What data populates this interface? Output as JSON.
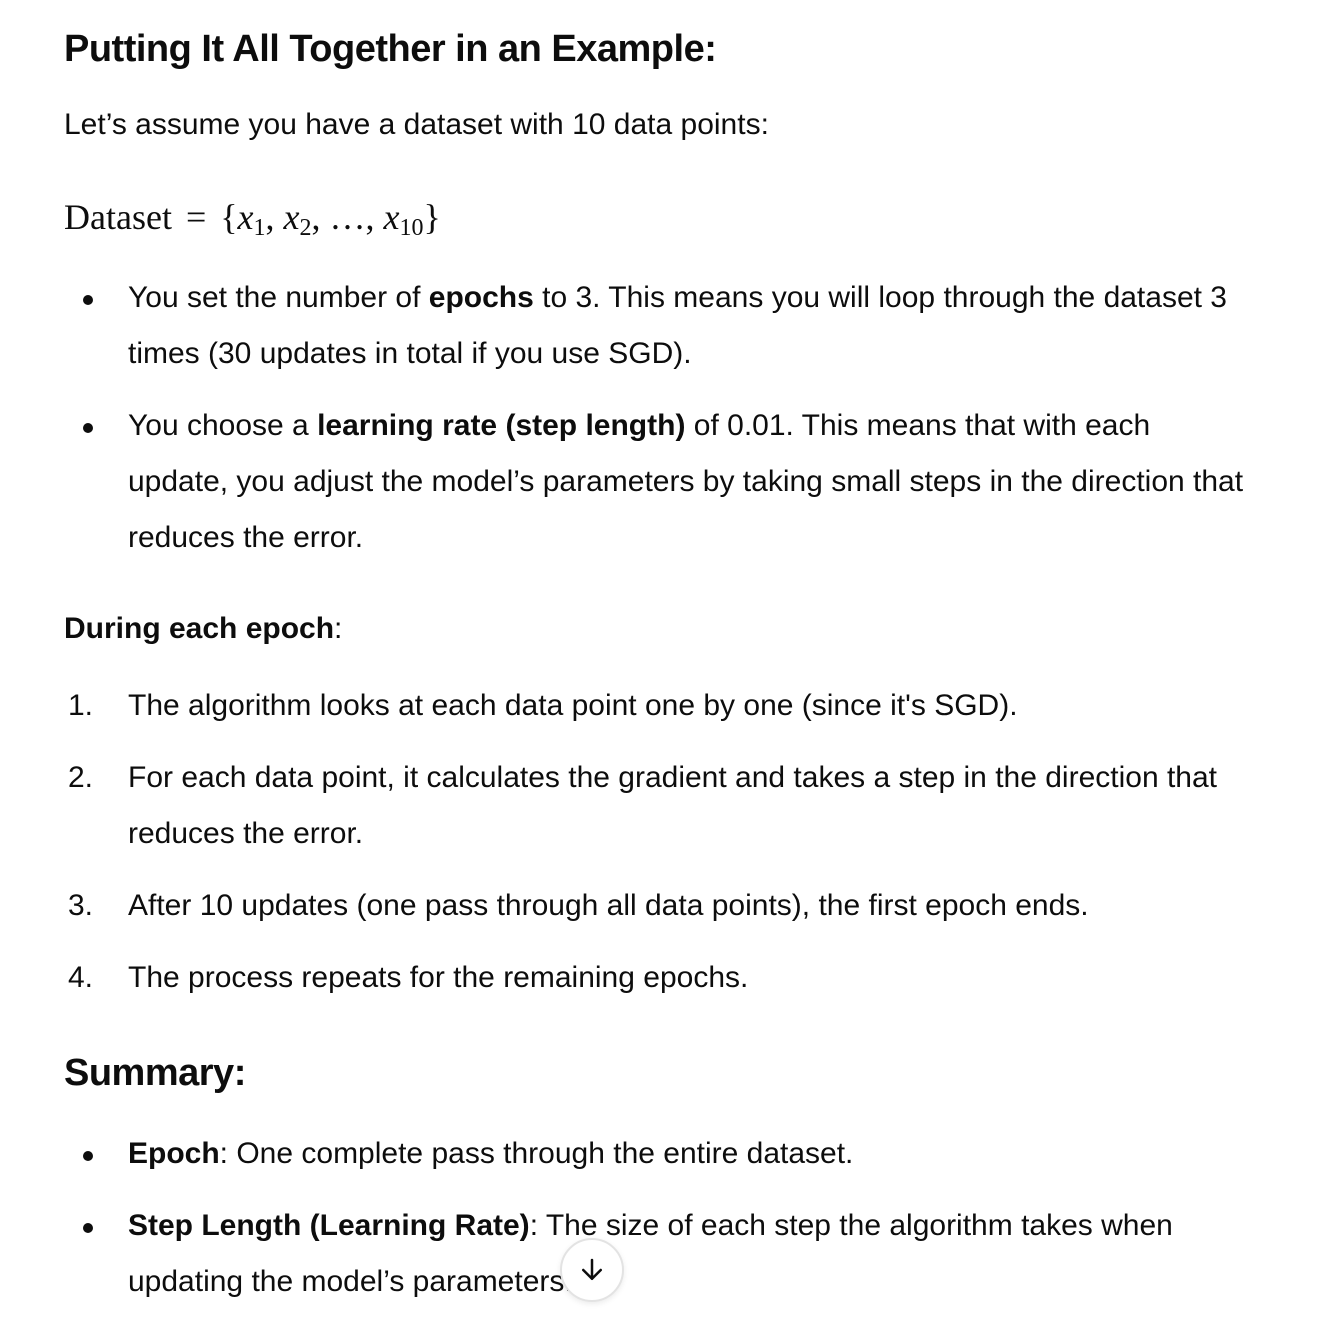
{
  "section1": {
    "heading": "Putting It All Together in an Example:",
    "intro": "Let’s assume you have a dataset with 10 data points:",
    "math": {
      "lhs": "Dataset",
      "rel": "=",
      "open": "{",
      "x1": "x",
      "x1_sub": "1",
      "x2": "x",
      "x2_sub": "2",
      "ellipsis": "…",
      "x10": "x",
      "x10_sub": "10",
      "close": "}",
      "comma": ","
    },
    "bullets": [
      {
        "pre": "You set the number of ",
        "bold": "epochs",
        "post": " to 3. This means you will loop through the dataset 3 times (30 updates in total if you use SGD)."
      },
      {
        "pre": "You choose a ",
        "bold": "learning rate (step length)",
        "post": " of 0.01. This means that with each update, you adjust the model’s parameters by taking small steps in the direction that reduces the error."
      }
    ]
  },
  "section2": {
    "subhead_bold": "During each epoch",
    "subhead_post": ":",
    "steps": [
      {
        "num": "1.",
        "text": "The algorithm looks at each data point one by one (since it's SGD)."
      },
      {
        "num": "2.",
        "text": "For each data point, it calculates the gradient and takes a step in the direction that reduces the error."
      },
      {
        "num": "3.",
        "text": "After 10 updates (one pass through all data points), the first epoch ends."
      },
      {
        "num": "4.",
        "text": "The process repeats for the remaining epochs."
      }
    ]
  },
  "summary": {
    "heading": "Summary:",
    "bullets": [
      {
        "bold": "Epoch",
        "post": ": One complete pass through the entire dataset."
      },
      {
        "bold": "Step Length (Learning Rate)",
        "post": ": The size of each step the algorithm takes when updating the model’s parameters."
      }
    ]
  },
  "scroll_button": {
    "icon": "arrow-down-icon"
  }
}
